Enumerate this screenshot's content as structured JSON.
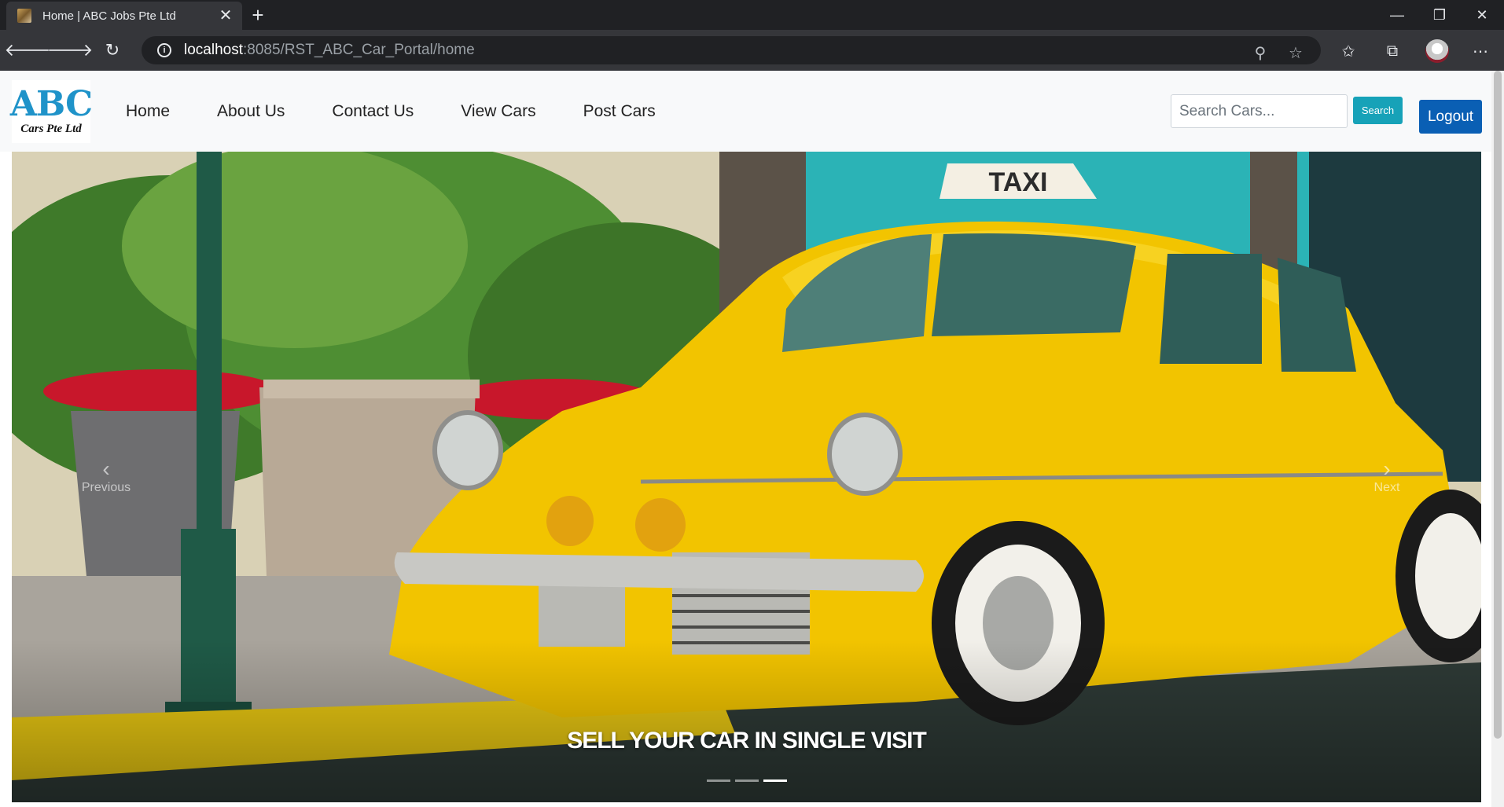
{
  "browser": {
    "tab_title": "Home | ABC Jobs Pte Ltd",
    "new_tab_symbol": "+",
    "url_host": "localhost",
    "url_path": ":8085/RST_ABC_Car_Portal/home"
  },
  "navbar": {
    "logo_main": "ABC",
    "logo_sub": "Cars Pte Ltd",
    "links": [
      "Home",
      "About Us",
      "Contact Us",
      "View Cars",
      "Post Cars"
    ],
    "search_placeholder": "Search Cars...",
    "search_button": "Search",
    "logout_button": "Logout"
  },
  "carousel": {
    "prev_label": "Previous",
    "next_label": "Next",
    "caption": "SELL YOUR CAR IN SINGLE VISIT",
    "slide_count": 3,
    "active_index": 2,
    "image_description": "Yellow vintage taxi parked by palm plants"
  },
  "colors": {
    "logo_blue": "#1f93c9",
    "search_button": "#17a2b8",
    "logout_button": "#0a5fb4",
    "taxi_yellow": "#f2c400"
  }
}
